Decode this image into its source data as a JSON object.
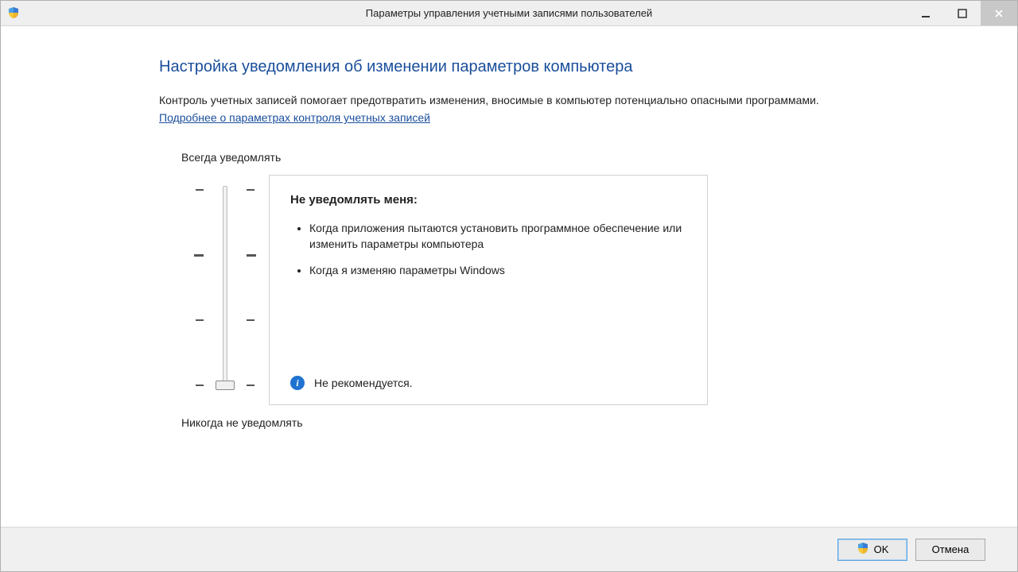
{
  "window": {
    "title": "Параметры управления учетными записями пользователей"
  },
  "page": {
    "heading": "Настройка уведомления об изменении параметров компьютера",
    "description": "Контроль учетных записей помогает предотвратить изменения, вносимые в компьютер потенциально опасными программами.",
    "more_link": "Подробнее о параметрах контроля учетных записей"
  },
  "slider": {
    "label_top": "Всегда уведомлять",
    "label_bottom": "Никогда не уведомлять",
    "levels": 4,
    "current_level": 0
  },
  "info": {
    "title": "Не уведомлять меня:",
    "items": [
      "Когда приложения пытаются установить программное обеспечение или изменить параметры компьютера",
      "Когда я изменяю параметры Windows"
    ],
    "recommendation": "Не рекомендуется."
  },
  "buttons": {
    "ok": "OK",
    "cancel": "Отмена"
  }
}
